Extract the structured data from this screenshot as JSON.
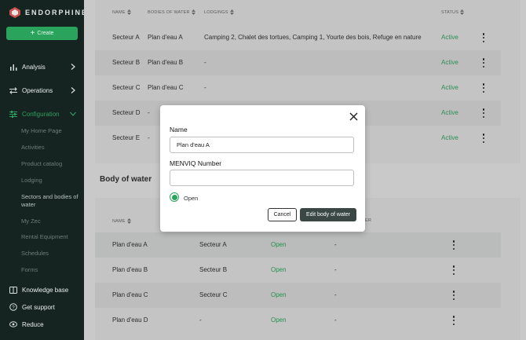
{
  "app": {
    "name": "ENDORPHINE",
    "create_label": "Create"
  },
  "sidebar": {
    "nav": [
      {
        "label": "Analysis",
        "icon": "bar-chart-icon"
      },
      {
        "label": "Operations",
        "icon": "arrows-icon"
      },
      {
        "label": "Configuration",
        "icon": "sliders-icon"
      }
    ],
    "sub_items": [
      "My Home Page",
      "Activities",
      "Product catalog",
      "Lodging",
      "Sectors and bodies of water",
      "My Zec",
      "Rental Equipment",
      "Schedules",
      "Forms"
    ],
    "bottom": [
      {
        "label": "Knowledge base",
        "icon": "book-icon"
      },
      {
        "label": "Get support",
        "icon": "help-circle-icon"
      },
      {
        "label": "Reduce",
        "icon": "eye-icon"
      }
    ]
  },
  "sectors_table": {
    "headers": {
      "name": "NAME",
      "bodies": "BODIES OF WATER",
      "lodgings": "LODGINGS",
      "status": "STATUS"
    },
    "rows": [
      {
        "name": "Secteur A",
        "bodies": "Plan d'eau A",
        "lodgings": "Camping 2, Chalet des tortues, Camping 1, Yourte des bois, Refuge en nature",
        "status": "Active"
      },
      {
        "name": "Secteur B",
        "bodies": "Plan d'eau B",
        "lodgings": "-",
        "status": "Active"
      },
      {
        "name": "Secteur C",
        "bodies": "Plan d'eau C",
        "lodgings": "-",
        "status": "Active"
      },
      {
        "name": "Secteur D",
        "bodies": "-",
        "lodgings": "",
        "status": "Active"
      },
      {
        "name": "Secteur E",
        "bodies": "-",
        "lodgings": "",
        "status": "Active"
      }
    ]
  },
  "body_of_water": {
    "title": "Body of water",
    "headers": {
      "name": "NAME",
      "col4": "ER"
    },
    "rows": [
      {
        "name": "Plan d'eau A",
        "sector": "Secteur A",
        "status": "Open",
        "extra": "-"
      },
      {
        "name": "Plan d'eau B",
        "sector": "Secteur B",
        "status": "Open",
        "extra": "-"
      },
      {
        "name": "Plan d'eau C",
        "sector": "Secteur C",
        "status": "Open",
        "extra": "-"
      },
      {
        "name": "Plan d'eau D",
        "sector": "-",
        "status": "Open",
        "extra": "-"
      }
    ]
  },
  "modal": {
    "name_label": "Name",
    "name_value": "Plan d'eau A",
    "menviq_label": "MENVIQ Number",
    "menviq_value": "",
    "open_label": "Open",
    "cancel_label": "Cancel",
    "submit_label": "Edit body of water"
  },
  "colors": {
    "accent": "#2aa45d",
    "sidebar": "#162421",
    "status_green": "#2a8e55"
  }
}
